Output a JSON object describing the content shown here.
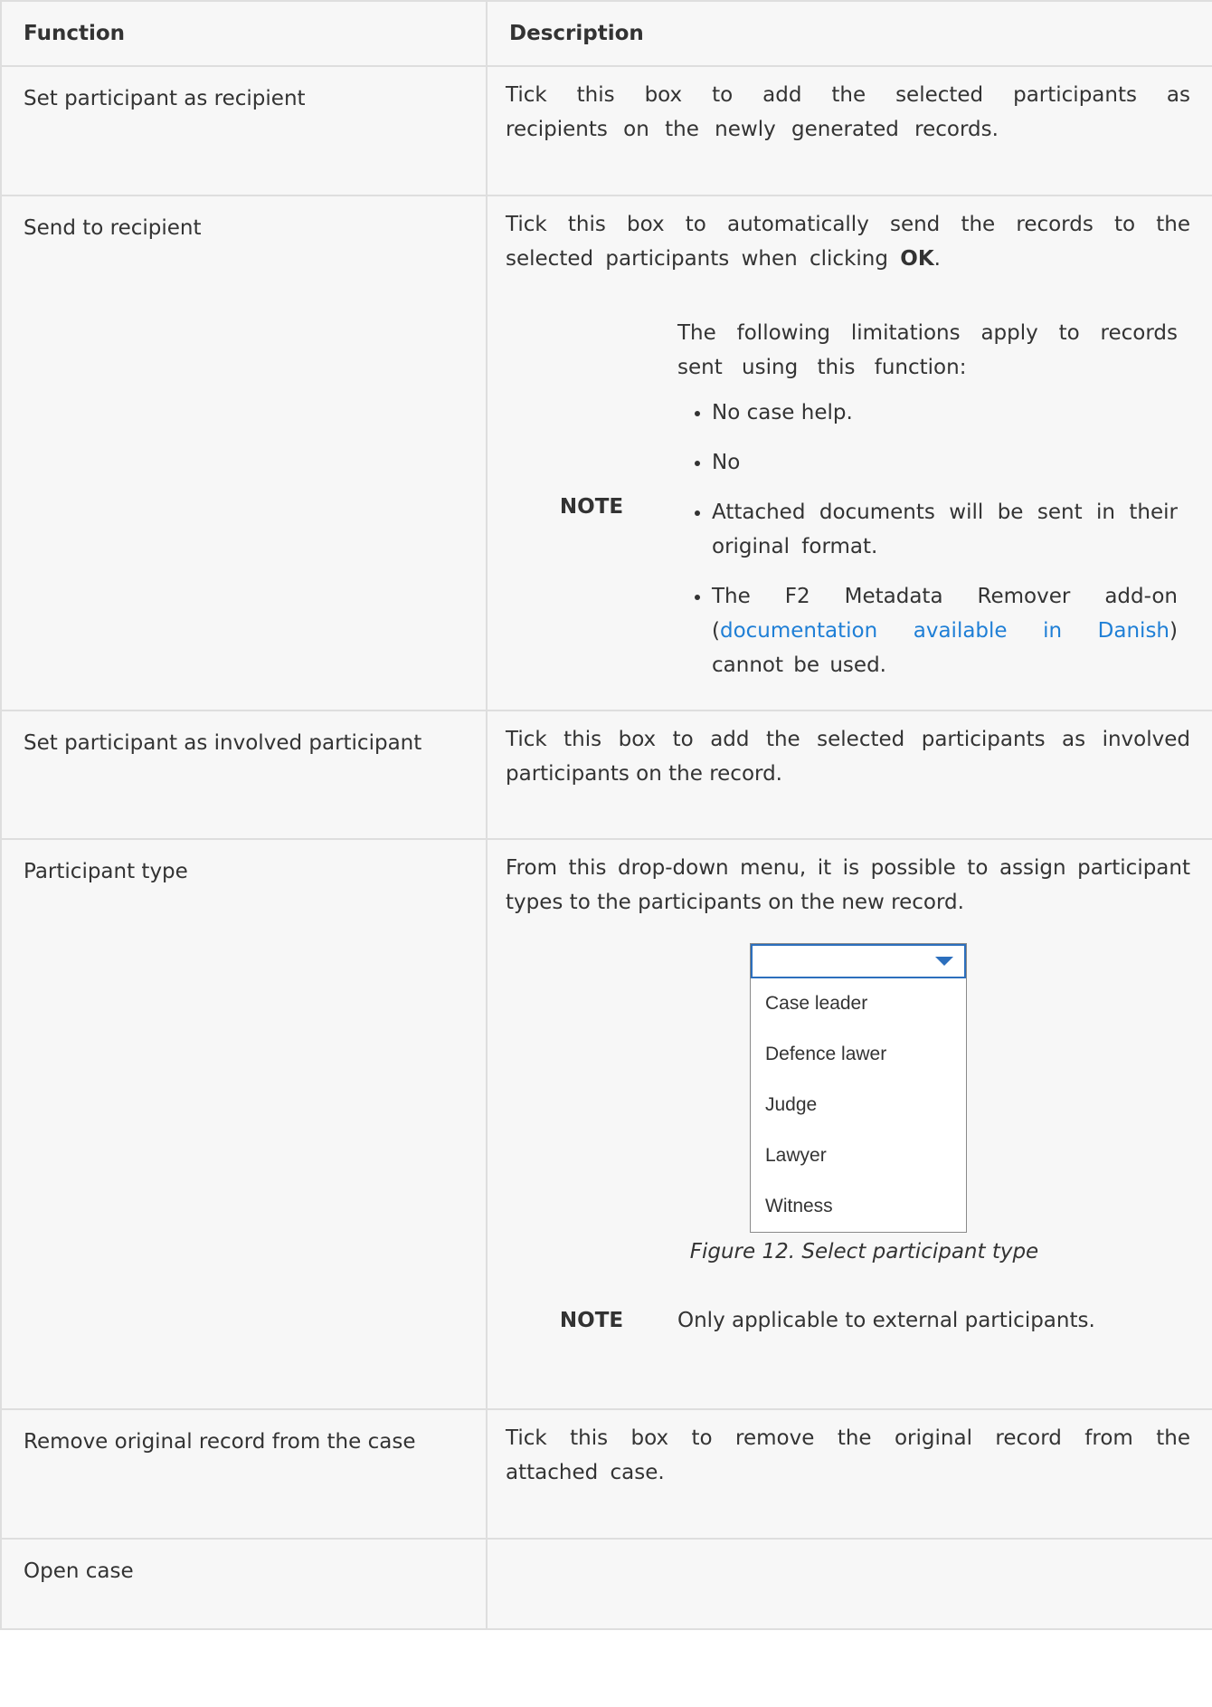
{
  "table": {
    "headers": [
      "Function",
      "Description"
    ],
    "rows": [
      {
        "function": "Set participant as recipient",
        "description": "Tick this box to add the selected participants as recipients on the newly generated records."
      },
      {
        "function": "Send to recipient",
        "description_pre": "Tick this box to automatically send the records to the selected participants when clicking ",
        "description_bold": "OK",
        "description_post": ".",
        "note": {
          "label": "NOTE",
          "intro": "The following limitations apply to records sent using this function:",
          "items": [
            "No case help.",
            "No",
            "Attached documents will be sent in their original format."
          ],
          "last_item_pre": "The F2 Metadata Remover add-on (",
          "last_item_link": "documentation available in Danish",
          "last_item_post": ") cannot be used."
        }
      },
      {
        "function": "Set participant as involved participant",
        "description": "Tick this box to add the selected participants as involved participants on the record."
      },
      {
        "function": "Participant type",
        "description": "From this drop-down menu, it is possible to assign participant types to the participants on the new record.",
        "dropdown_options": [
          "Case leader",
          "Defence lawer",
          "Judge",
          "Lawyer",
          "Witness"
        ],
        "caption": "Figure 12. Select participant type",
        "note": {
          "label": "NOTE",
          "text": "Only applicable to external participants."
        }
      },
      {
        "function": "Remove original record from the case",
        "description": "Tick this box to remove the original record from the attached case."
      },
      {
        "function": "Open case",
        "description": ""
      }
    ]
  },
  "colors": {
    "border": "#dedede",
    "cell_bg": "#f7f7f7",
    "text": "#333333",
    "link": "#1f7fd6",
    "dropdown_accent": "#2c6fbd"
  }
}
